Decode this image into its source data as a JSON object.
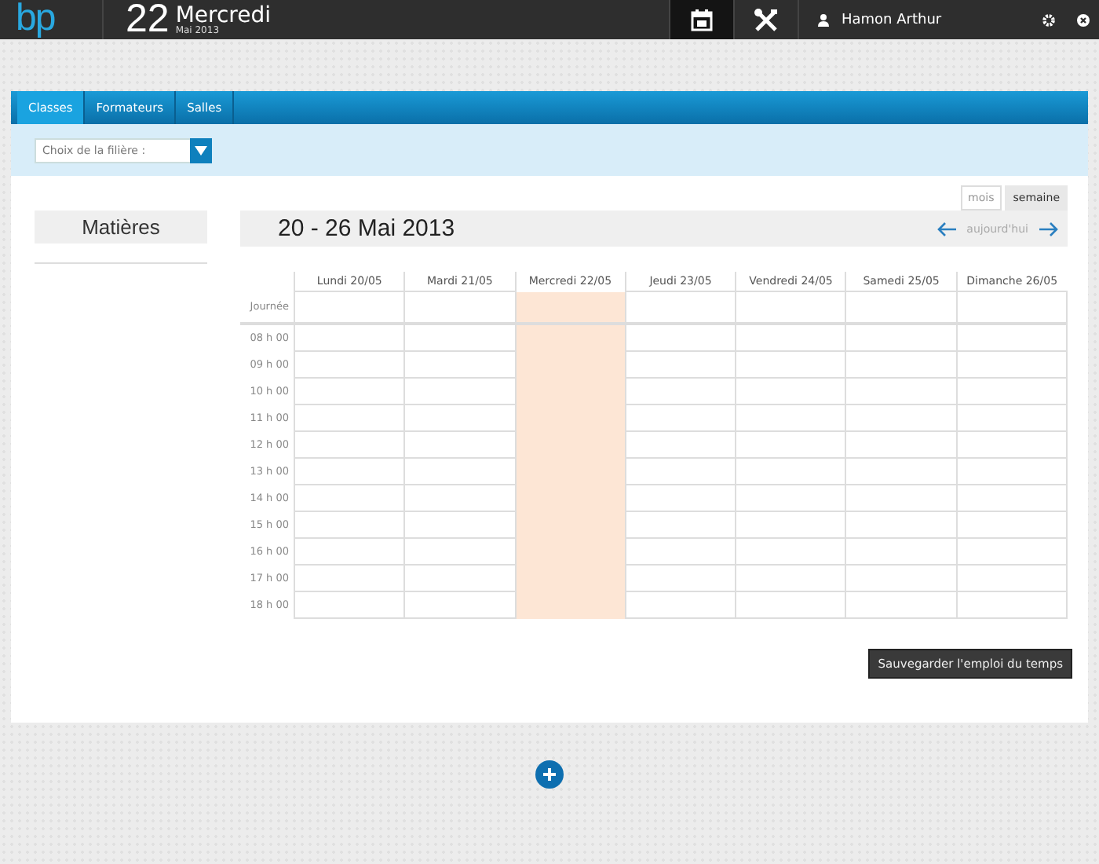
{
  "header": {
    "logo": "bp",
    "day_number": "22",
    "weekday": "Mercredi",
    "month_year": "Mai 2013",
    "nav_buttons": [
      {
        "kind": "calendar",
        "selected": true
      },
      {
        "kind": "tools",
        "selected": false
      }
    ],
    "user_name": "Hamon Arthur"
  },
  "tabs": [
    {
      "label": "Classes",
      "selected": true
    },
    {
      "label": "Formateurs",
      "selected": false
    },
    {
      "label": "Salles",
      "selected": false
    }
  ],
  "filter": {
    "placeholder": "Choix de la filière :"
  },
  "subjects": {
    "title": "Matières"
  },
  "week": {
    "title": "20 - 26 Mai 2013",
    "today_label": "aujourd'hui",
    "views": [
      {
        "label": "mois",
        "selected": false
      },
      {
        "label": "semaine",
        "selected": true
      }
    ]
  },
  "calendar": {
    "all_day_label": "Journée",
    "days": [
      {
        "label": "Lundi 20/05",
        "today": false
      },
      {
        "label": "Mardi 21/05",
        "today": false
      },
      {
        "label": "Mercredi 22/05",
        "today": true
      },
      {
        "label": "Jeudi 23/05",
        "today": false
      },
      {
        "label": "Vendredi 24/05",
        "today": false
      },
      {
        "label": "Samedi 25/05",
        "today": false
      },
      {
        "label": "Dimanche 26/05",
        "today": false
      }
    ],
    "hours": [
      "08 h 00",
      "09 h 00",
      "10 h 00",
      "11 h 00",
      "12 h 00",
      "13 h 00",
      "14 h 00",
      "15 h 00",
      "16 h 00",
      "17 h 00",
      "18 h 00"
    ]
  },
  "save_button": "Sauvegarder l'emploi du temps"
}
